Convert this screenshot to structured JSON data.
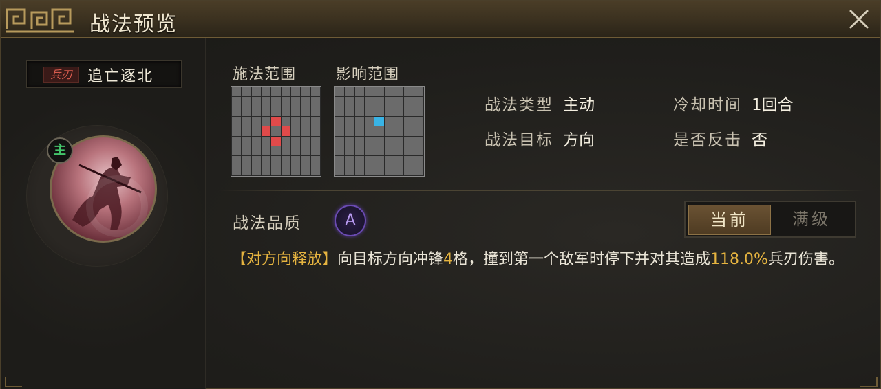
{
  "window": {
    "title": "战法预览"
  },
  "skill": {
    "type_tag": "兵刃",
    "name": "追亡逐北",
    "badge": "主"
  },
  "ranges": {
    "cast_label": "施法范围",
    "effect_label": "影响范围"
  },
  "attributes": {
    "type_key": "战法类型",
    "type_val": "主动",
    "cooldown_key": "冷却时间",
    "cooldown_val": "1回合",
    "target_key": "战法目标",
    "target_val": "方向",
    "counter_key": "是否反击",
    "counter_val": "否"
  },
  "quality": {
    "label": "战法品质",
    "grade": "A"
  },
  "toggle": {
    "current": "当前",
    "max": "满级"
  },
  "description": {
    "tag": "【对方向释放】",
    "part1": "向目标方向冲锋",
    "num1": "4",
    "part2": "格，撞到第一个敌军时停下并对其造成",
    "num2": "118.0%",
    "part3": "兵刃伤害。"
  },
  "colors": {
    "highlight": "#e6b440",
    "cast_cell": "#e04a4a",
    "effect_cell": "#39b4e6",
    "badge_main": "#43c56a"
  }
}
